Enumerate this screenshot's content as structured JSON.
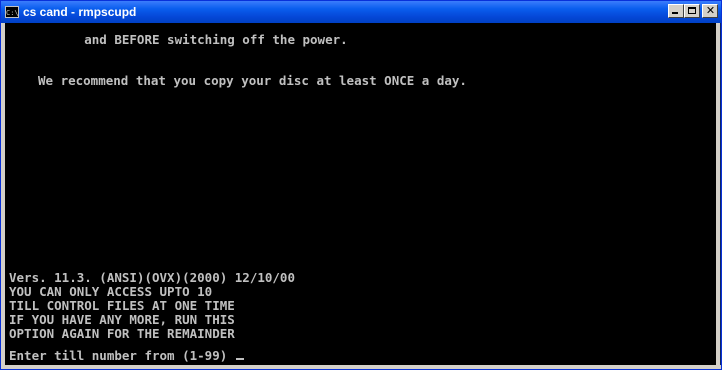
{
  "window": {
    "title": "cs cand - rmpscupd",
    "icon_text": "C:\\",
    "buttons": {
      "minimize": "minimize-icon",
      "maximize": "maximize-icon",
      "close": "close-icon",
      "close_glyph": "✕"
    }
  },
  "console": {
    "top_lines": [
      "          and BEFORE switching off the power.",
      "We recommend that you copy your disc at least ONCE a day."
    ],
    "bottom_lines": [
      "Vers. 11.3. (ANSI)(OVX)(2000) 12/10/00",
      "YOU CAN ONLY ACCESS UPTO 10",
      "TILL CONTROL FILES AT ONE TIME",
      "IF YOU HAVE ANY MORE, RUN THIS",
      "OPTION AGAIN FOR THE REMAINDER"
    ],
    "prompt": "Enter till number from (1-99) "
  },
  "colors": {
    "titlebar": "#0548d8",
    "console_bg": "#000000",
    "console_text": "#c0c0c0"
  }
}
